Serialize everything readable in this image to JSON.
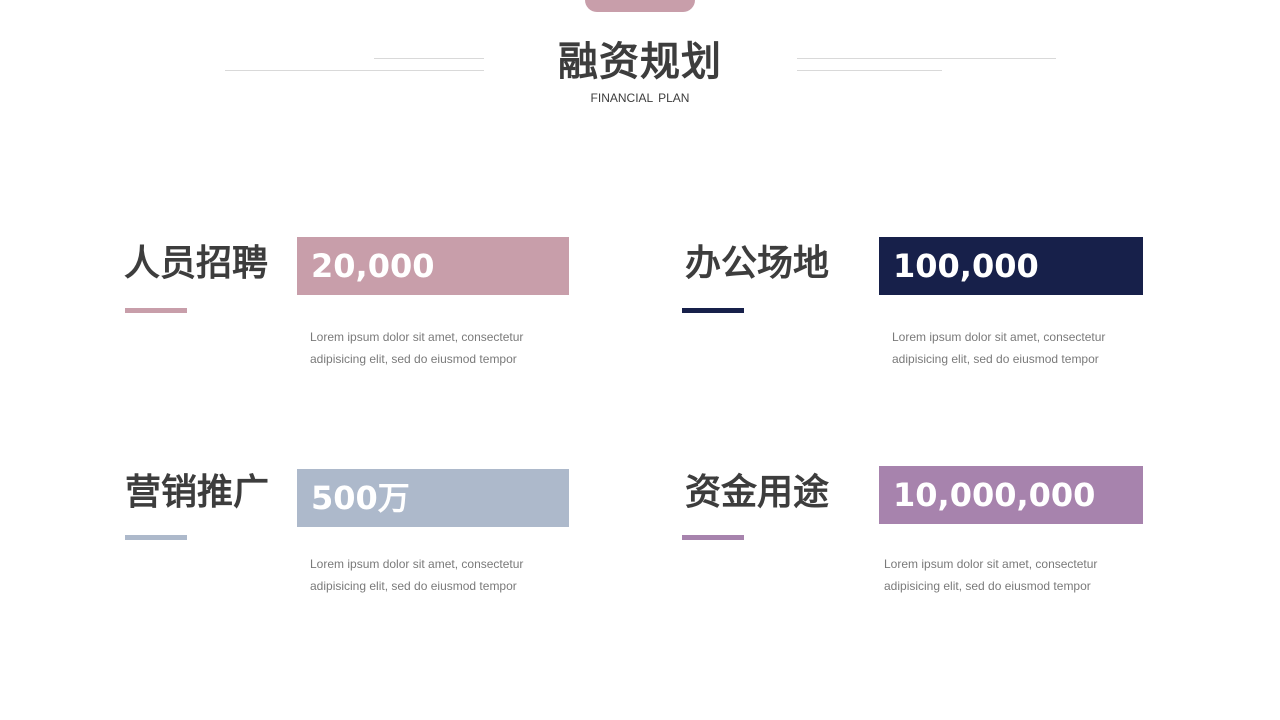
{
  "header": {
    "title": "融资规划",
    "subtitle": "FINANCIAL   PLAN",
    "accent": "#c89eaa"
  },
  "cards": [
    {
      "title": "人员招聘",
      "value": "20,000",
      "description": "Lorem ipsum dolor sit amet, consectetur\nadipisicing elit, sed do eiusmod tempor",
      "color": "#c89eaa"
    },
    {
      "title": "办公场地",
      "value": "100,000",
      "description": "Lorem ipsum dolor sit amet, consectetur\nadipisicing elit, sed do eiusmod tempor",
      "color": "#17204a"
    },
    {
      "title": "营销推广",
      "value": "500万",
      "description": "Lorem ipsum dolor sit amet, consectetur\nadipisicing elit, sed do eiusmod tempor",
      "color": "#adb9cb"
    },
    {
      "title": "资金用途",
      "value": "10,000,000",
      "description": "Lorem ipsum dolor sit amet, consectetur\nadipisicing elit, sed do eiusmod tempor",
      "color": "#a783ad"
    }
  ]
}
